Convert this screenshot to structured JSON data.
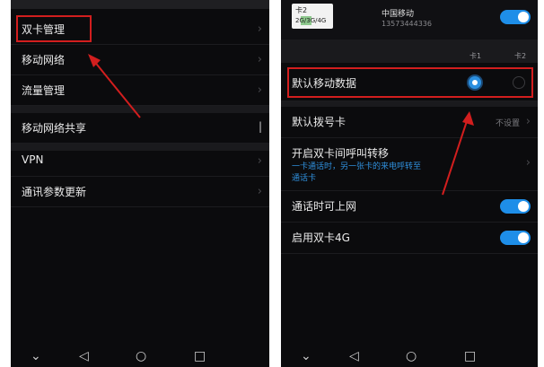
{
  "left_screen": {
    "items": [
      {
        "label": "双卡管理"
      },
      {
        "label": "移动网络"
      },
      {
        "label": "流量管理"
      },
      {
        "label": "移动网络共享"
      },
      {
        "label": "VPN"
      },
      {
        "label": "通讯参数更新"
      }
    ]
  },
  "right_screen": {
    "sim": {
      "card_label": "卡2",
      "network_type": "2G/3G/4G",
      "carrier": "中国移动",
      "number": "13573444336"
    },
    "col_labels": [
      "卡1",
      "卡2"
    ],
    "default_data": {
      "label": "默认移动数据",
      "selected_card": "卡1"
    },
    "default_dial": {
      "label": "默认拨号卡",
      "value": "不设置"
    },
    "call_forward": {
      "label": "开启双卡间呼叫转移",
      "desc_prefix": "一卡通话时，另一张卡的来电呼转至",
      "desc_suffix": "通话卡"
    },
    "data_during_call": {
      "label": "通话时可上网",
      "on": true
    },
    "dual_4g": {
      "label": "启用双卡4G",
      "on": true
    }
  },
  "nav": {
    "icons": [
      "chevron-down-icon",
      "back-triangle-icon",
      "home-circle-icon",
      "recents-square-icon"
    ]
  },
  "colors": {
    "toggle_on": "#1e8ee8",
    "highlight": "#d21e1e",
    "background": "#0b0b0d"
  }
}
